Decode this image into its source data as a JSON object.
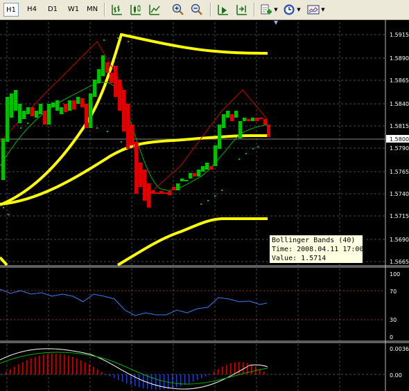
{
  "toolbar": {
    "timeframes": [
      "H1",
      "H4",
      "D1",
      "W1",
      "MN"
    ],
    "active_timeframe": "H1",
    "icons": [
      "bar-chart-icon",
      "candlesticks-icon",
      "line-chart-icon",
      "zoom-in-icon",
      "zoom-out-icon",
      "chart-shift-icon",
      "auto-scroll-icon",
      "indicators-icon",
      "periods-icon",
      "templates-icon"
    ]
  },
  "tooltip": {
    "line1": "Bollinger Bands (40)",
    "line2": "Time: 2008.04.11 17:00",
    "line3": "Value: 1.5714"
  },
  "price_axis": {
    "labels": [
      "1.5915",
      "1.5890",
      "1.5865",
      "1.5840",
      "1.5815",
      "1.5790",
      "1.5765",
      "1.5740",
      "1.5715",
      "1.5690",
      "1.5665"
    ],
    "current_price": "1.5800"
  },
  "rsi_axis": {
    "labels": [
      "100",
      "70",
      "30",
      "0"
    ]
  },
  "macd_axis": {
    "labels": [
      "0.0036",
      "0.00"
    ]
  },
  "colors": {
    "background": "#000000",
    "grid": "#4a4a4a",
    "bull_candle": "#00c000",
    "bear_candle": "#e00000",
    "bollinger": "#ffff00",
    "ma_line": "#00b000",
    "rsi_line": "#3e7cf2",
    "macd_line": "#ffffff"
  }
}
